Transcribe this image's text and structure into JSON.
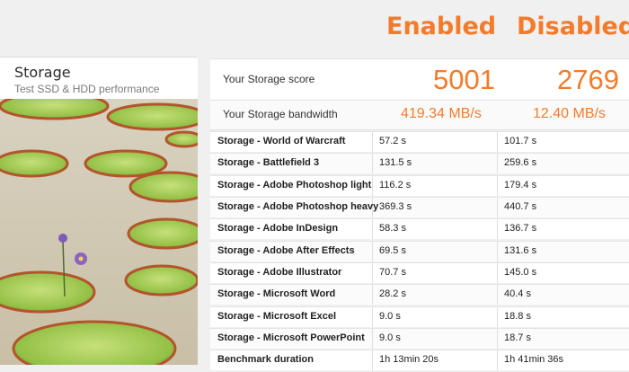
{
  "columns": {
    "enabled": "Enabled",
    "disabled": "Disabled"
  },
  "card": {
    "title": "Storage",
    "subtitle": "Test SSD & HDD performance"
  },
  "score": {
    "label": "Your Storage score",
    "enabled": "5001",
    "disabled": "2769"
  },
  "bandwidth": {
    "label": "Your Storage bandwidth",
    "enabled": "419.34 MB/s",
    "disabled": "12.40 MB/s"
  },
  "rows": [
    {
      "name": "Storage - World of Warcraft",
      "enabled": "57.2 s",
      "disabled": "101.7 s"
    },
    {
      "name": "Storage - Battlefield 3",
      "enabled": "131.5 s",
      "disabled": "259.6 s"
    },
    {
      "name": "Storage - Adobe Photoshop light",
      "enabled": "116.2 s",
      "disabled": "179.4 s"
    },
    {
      "name": "Storage - Adobe Photoshop heavy",
      "enabled": "369.3 s",
      "disabled": "440.7 s"
    },
    {
      "name": "Storage - Adobe InDesign",
      "enabled": "58.3 s",
      "disabled": "136.7 s"
    },
    {
      "name": "Storage - Adobe After Effects",
      "enabled": "69.5 s",
      "disabled": "131.6 s"
    },
    {
      "name": "Storage - Adobe Illustrator",
      "enabled": "70.7 s",
      "disabled": "145.0 s"
    },
    {
      "name": "Storage - Microsoft Word",
      "enabled": "28.2 s",
      "disabled": "40.4 s"
    },
    {
      "name": "Storage - Microsoft Excel",
      "enabled": "9.0 s",
      "disabled": "18.8 s"
    },
    {
      "name": "Storage - Microsoft PowerPoint",
      "enabled": "9.0 s",
      "disabled": "18.7 s"
    },
    {
      "name": "Benchmark duration",
      "enabled": "1h 13min 20s",
      "disabled": "1h 41min 36s"
    }
  ],
  "colors": {
    "accent": "#f47b2a"
  }
}
